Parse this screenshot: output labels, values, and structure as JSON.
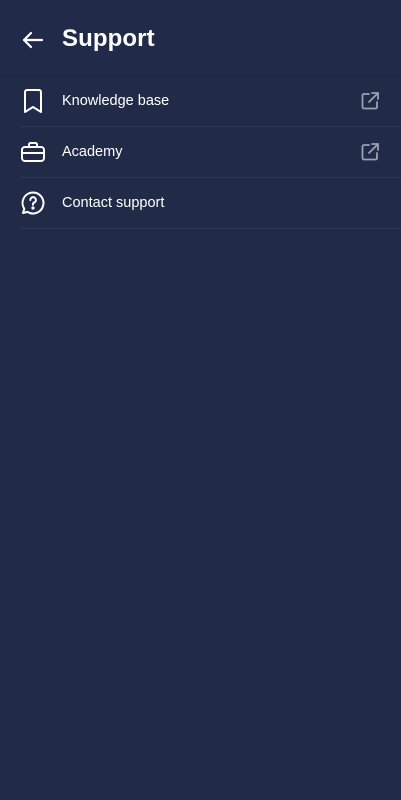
{
  "header": {
    "title": "Support",
    "back_icon": "arrow-left-icon"
  },
  "menu": {
    "items": [
      {
        "label": "Knowledge base",
        "icon": "bookmark-icon",
        "trailing_icon": "external-link-icon"
      },
      {
        "label": "Academy",
        "icon": "briefcase-icon",
        "trailing_icon": "external-link-icon"
      },
      {
        "label": "Contact support",
        "icon": "help-chat-icon",
        "trailing_icon": ""
      }
    ]
  },
  "colors": {
    "background": "#212a47",
    "text": "#ffffff",
    "secondary_icon": "#9aa1b4",
    "divider": "#2c3552"
  }
}
